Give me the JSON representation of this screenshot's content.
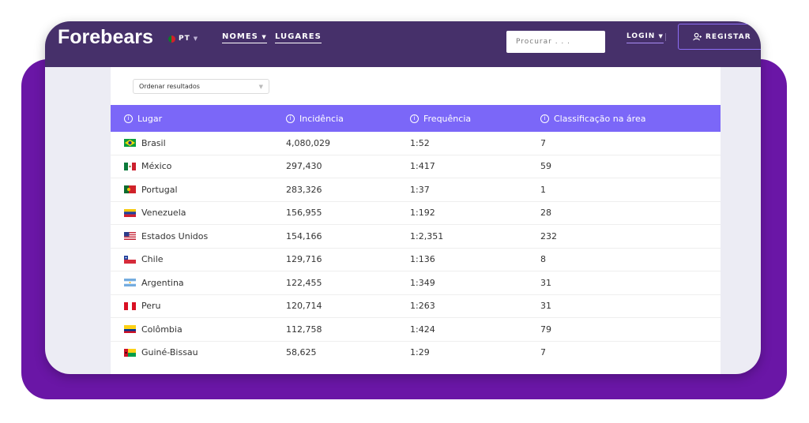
{
  "brand": {
    "logo_text": "Forebears"
  },
  "nav": {
    "language": "PT",
    "names": "NOMES",
    "places": "LUGARES",
    "search_placeholder": "Procurar . . .",
    "login": "LOGIN",
    "register": "REGISTAR"
  },
  "sort": {
    "selected": "Ordenar resultados"
  },
  "table": {
    "headers": [
      "Lugar",
      "Incidência",
      "Frequência",
      "Classificação na área"
    ],
    "rows": [
      {
        "place": "Brasil",
        "flag": "brazil-flag-icon",
        "incidence": "4,080,029",
        "frequency": "1:52",
        "rank": "7"
      },
      {
        "place": "México",
        "flag": "mexico-flag-icon",
        "incidence": "297,430",
        "frequency": "1:417",
        "rank": "59"
      },
      {
        "place": "Portugal",
        "flag": "portugal-flag-icon",
        "incidence": "283,326",
        "frequency": "1:37",
        "rank": "1"
      },
      {
        "place": "Venezuela",
        "flag": "venezuela-flag-icon",
        "incidence": "156,955",
        "frequency": "1:192",
        "rank": "28"
      },
      {
        "place": "Estados Unidos",
        "flag": "usa-flag-icon",
        "incidence": "154,166",
        "frequency": "1:2,351",
        "rank": "232"
      },
      {
        "place": "Chile",
        "flag": "chile-flag-icon",
        "incidence": "129,716",
        "frequency": "1:136",
        "rank": "8"
      },
      {
        "place": "Argentina",
        "flag": "argentina-flag-icon",
        "incidence": "122,455",
        "frequency": "1:349",
        "rank": "31"
      },
      {
        "place": "Peru",
        "flag": "peru-flag-icon",
        "incidence": "120,714",
        "frequency": "1:263",
        "rank": "31"
      },
      {
        "place": "Colômbia",
        "flag": "colombia-flag-icon",
        "incidence": "112,758",
        "frequency": "1:424",
        "rank": "79"
      },
      {
        "place": "Guiné-Bissau",
        "flag": "guinea-bissau-flag-icon",
        "incidence": "58,625",
        "frequency": "1:29",
        "rank": "7"
      }
    ]
  },
  "colors": {
    "navbar": "#46306a",
    "table_header": "#7b67f8",
    "backdrop": "#6a16a6",
    "register_border": "#8d6ef5"
  }
}
